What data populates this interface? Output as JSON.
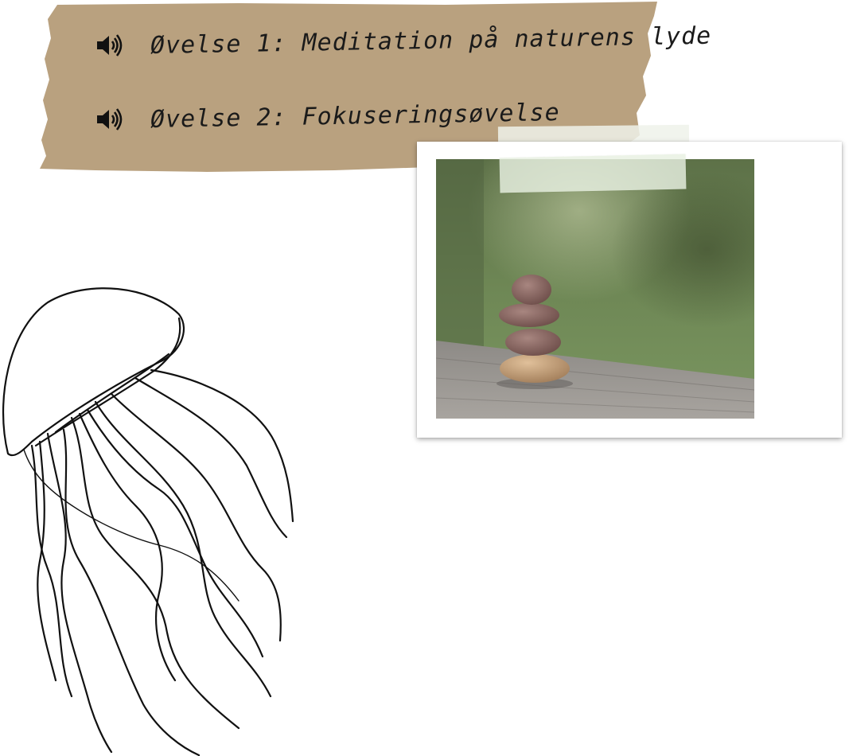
{
  "exercises": [
    {
      "label": "Øvelse 1: Meditation på naturens lyde",
      "icon": "speaker-icon"
    },
    {
      "label": "Øvelse 2: Fokuseringsøvelse",
      "icon": "speaker-icon"
    }
  ],
  "colors": {
    "banner": "#b9a17f",
    "text": "#1a1a1a",
    "tape": "#e8f0e2"
  },
  "illustration": {
    "icon": "jellyfish-icon"
  },
  "photo": {
    "subject": "stacked-stones-image"
  }
}
